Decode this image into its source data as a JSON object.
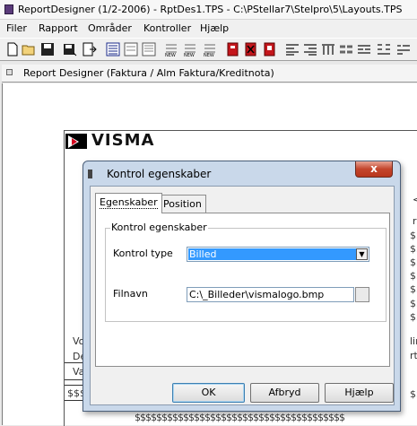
{
  "window": {
    "title": "ReportDesigner (1/2-2006) - RptDes1.TPS - C:\\PStellar7\\Stelpro\\5\\Layouts.TPS"
  },
  "menu": [
    "Filer",
    "Rapport",
    "Områder",
    "Kontroller",
    "Hjælp"
  ],
  "toolbar_icons": [
    "new-icon",
    "open-icon",
    "save-icon",
    "save-as-icon",
    "export-icon",
    "list-icon",
    "doc-icon",
    "doc-lines-icon",
    "new-field-icon",
    "new-field-2-icon",
    "new-field-3-icon",
    "red-book-icon",
    "red-book-x-icon",
    "red-book-2-icon",
    "align-1-icon",
    "align-2-icon",
    "align-3-icon",
    "align-4-icon",
    "align-5-icon",
    "align-6-icon"
  ],
  "child": {
    "title": "Report Designer (Faktura / Alm Faktura/Kreditnota)"
  },
  "report_bg": {
    "logo": "VISMA",
    "right_chars": [
      "<",
      "ri",
      "$$",
      "$$",
      "$$",
      "$$",
      "$$",
      "$$",
      "$$",
      "lir",
      "rti",
      "$$"
    ],
    "left_texts": [
      "Vo",
      "De",
      "Va",
      "$$$"
    ],
    "bottom_text": "$$$$$$$$$$$$$$$$$$$$$$$$$$$$$$$$$$$$$$$"
  },
  "dialog": {
    "title": "Kontrol egenskaber",
    "close": "x",
    "tabs": [
      "Egenskaber",
      "Position"
    ],
    "group_label": "Kontrol egenskaber",
    "type_label": "Kontrol type",
    "type_value": "Billed",
    "file_label": "Filnavn",
    "file_value": "C:\\_Billeder\\vismalogo.bmp",
    "ok": "OK",
    "cancel": "Afbryd",
    "help": "Hjælp"
  }
}
